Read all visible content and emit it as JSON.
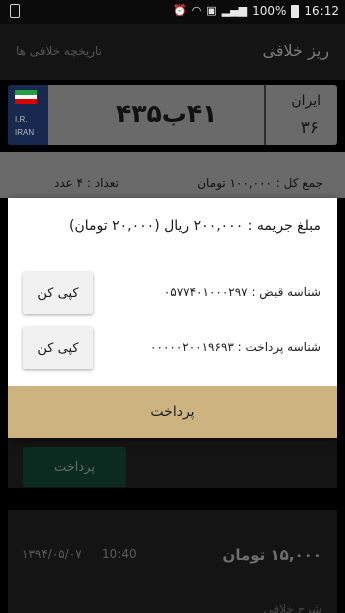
{
  "status_bar": {
    "battery": "100%",
    "time": "16:12"
  },
  "app_bar": {
    "title": "ریز خلافی",
    "history_link": "تاریخچه خلافی ها"
  },
  "plate": {
    "flag_colors": [
      "#239f40",
      "#ffffff",
      "#da0000"
    ],
    "ir_label": "I.R.",
    "iran_label": "IRAN",
    "number": "۴۱ب۴۳۵",
    "country": "ایران",
    "code": "۳۶"
  },
  "summary": {
    "total": "جمع کل : ۱۰۰,۰۰۰ تومان",
    "count": "تعداد : ۴ عدد"
  },
  "dialog": {
    "title": "مبلغ جریمه : ۲۰۰,۰۰۰ ریال (۲۰,۰۰۰ تومان)",
    "bill_id": "شناسه قبض : ۰۵۷۷۴۰۱۰۰۰۲۹۷",
    "payment_id": "شناسه پرداخت : ۰۰۰۰۰۲۰۰۱۹۶۹۳",
    "copy_label": "کپی کن",
    "pay_label": "پرداخت",
    "pay_color": "#cdb37f"
  },
  "background": {
    "pay_label": "پرداخت",
    "record_amount": "۱۵,۰۰۰ تومان",
    "record_time": "10:40",
    "record_date": "۱۳۹۴/۰۵/۰۷",
    "record_bottom": "شرح خلافی"
  }
}
